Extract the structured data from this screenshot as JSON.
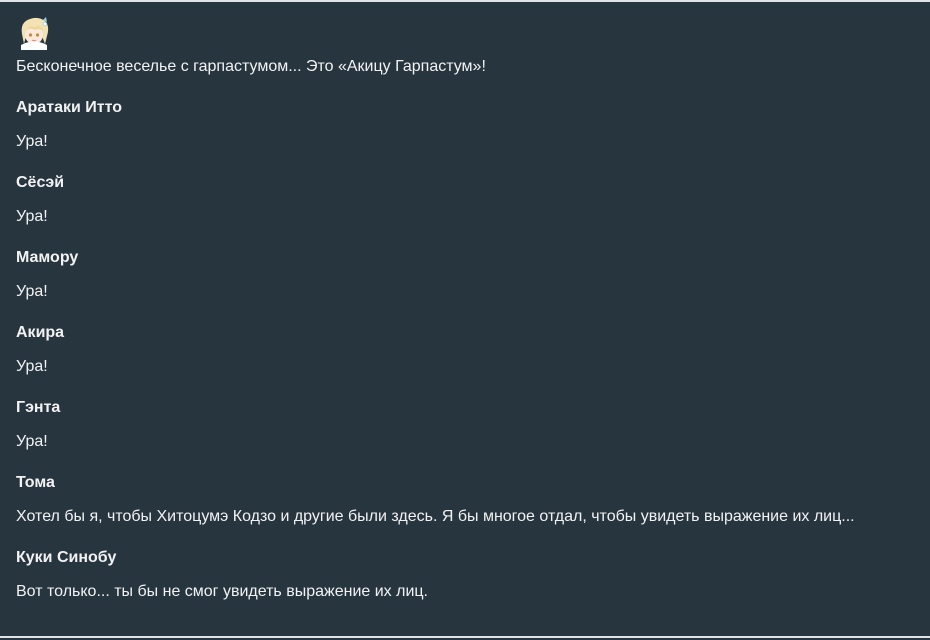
{
  "scene": {
    "avatar_icon": "character-portrait-icon",
    "narration": "Бесконечное веселье с гарпастумом... Это «Акицу Гарпастум»!"
  },
  "dialogue": [
    {
      "speaker": "Аратаки Итто",
      "text": "Ура!"
    },
    {
      "speaker": "Сёсэй",
      "text": "Ура!"
    },
    {
      "speaker": "Мамору",
      "text": "Ура!"
    },
    {
      "speaker": "Акира",
      "text": "Ура!"
    },
    {
      "speaker": "Гэнта",
      "text": "Ура!"
    },
    {
      "speaker": "Тома",
      "text": "Хотел бы я, чтобы Хитоцумэ Кодзо и другие были здесь. Я бы многое отдал, чтобы увидеть выражение их лиц..."
    },
    {
      "speaker": "Куки Синобу",
      "text": "Вот только... ты бы не смог увидеть выражение их лиц."
    }
  ]
}
